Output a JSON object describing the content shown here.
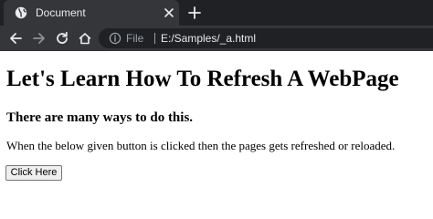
{
  "browser": {
    "tab": {
      "title": "Document",
      "favicon": "globe-icon",
      "close_icon": "close-icon"
    },
    "new_tab_icon": "plus-icon",
    "nav": {
      "back_icon": "back-arrow-icon",
      "forward_icon": "forward-arrow-icon",
      "reload_icon": "reload-icon",
      "home_icon": "home-icon"
    },
    "address": {
      "info_icon": "info-icon",
      "scheme_label": "File",
      "url": "E:/Samples/_a.html"
    },
    "colors": {
      "tabstrip": "#202124",
      "active_tab": "#35363a",
      "omnibox": "#202124",
      "text_light": "#e8eaed",
      "text_dim": "#9aa0a6"
    }
  },
  "page": {
    "heading": "Let's Learn How To Refresh A WebPage",
    "subheading": "There are many ways to do this.",
    "paragraph": "When the below given button is clicked then the pages gets refreshed or reloaded.",
    "button_label": "Click Here"
  }
}
